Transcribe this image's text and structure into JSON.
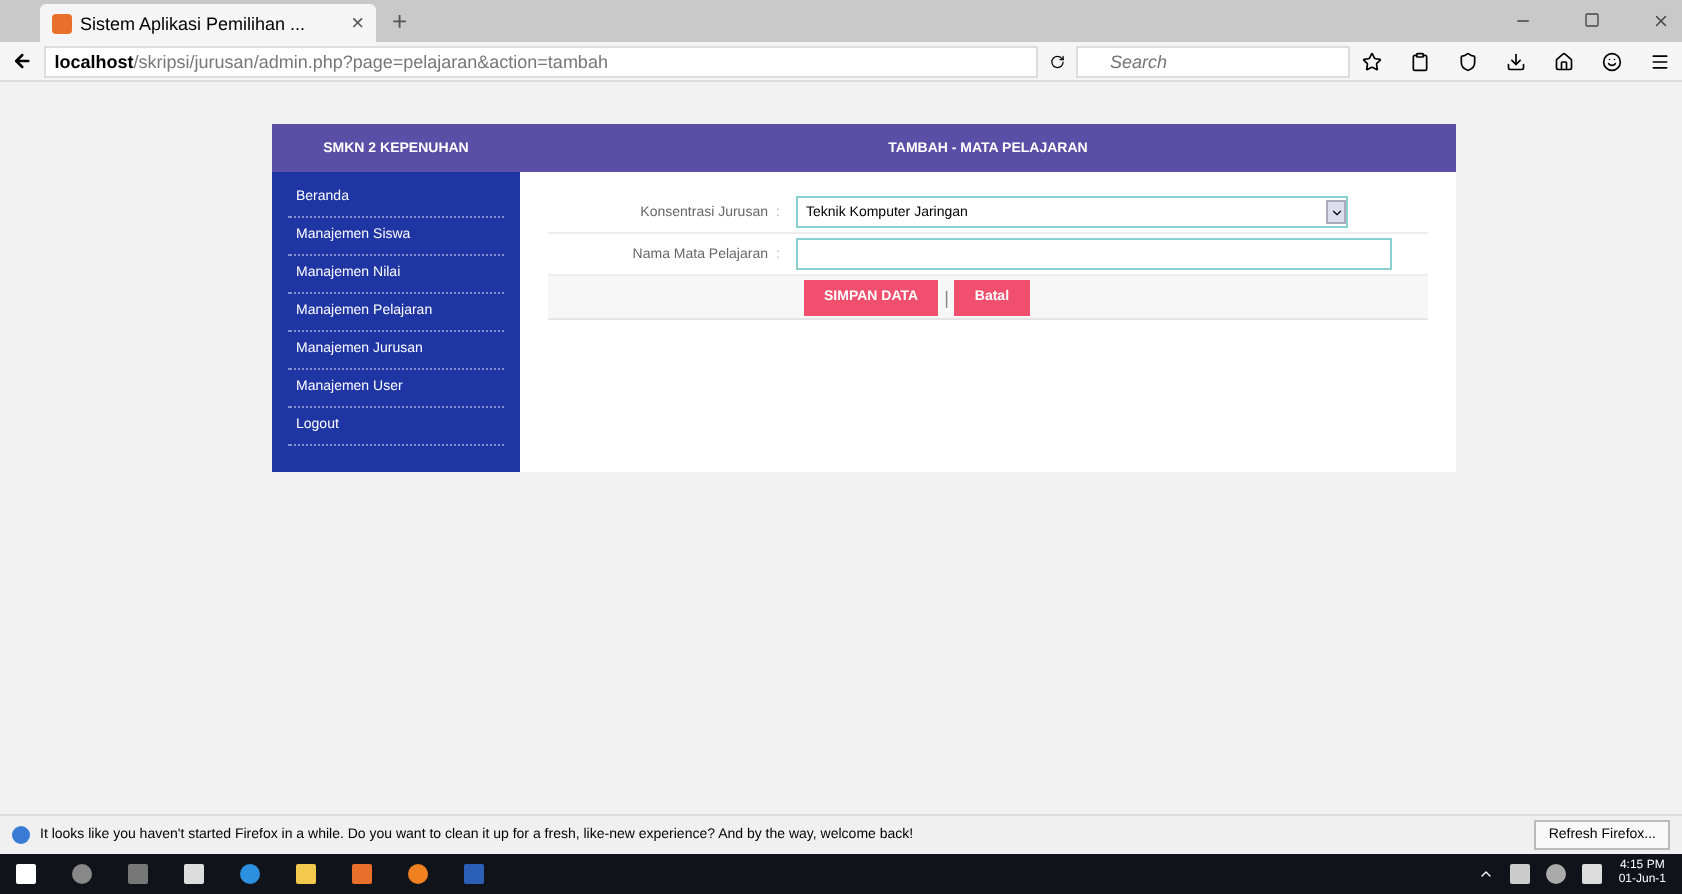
{
  "browser": {
    "tab": {
      "title": "Sistem Aplikasi Pemilihan ...",
      "close": "×"
    },
    "new_tab": "+",
    "url_host": "localhost",
    "url_path": "/skripsi/jurusan/admin.php?page=pelajaran&action=tambah",
    "search": {
      "placeholder": "Search"
    }
  },
  "app": {
    "brand": "SMKN 2 KEPENUHAN",
    "title": "TAMBAH - MATA PELAJARAN",
    "sidebar": [
      {
        "label": "Beranda"
      },
      {
        "label": "Manajemen Siswa"
      },
      {
        "label": "Manajemen Nilai"
      },
      {
        "label": "Manajemen Pelajaran"
      },
      {
        "label": "Manajemen Jurusan"
      },
      {
        "label": "Manajemen User"
      },
      {
        "label": "Logout"
      }
    ],
    "fields": [
      {
        "kind": "select",
        "label": "Konsentrasi Jurusan",
        "sep": ":",
        "value": "Teknik Komputer Jaringan"
      },
      {
        "kind": "text",
        "label": "Nama Mata Pelajaran",
        "sep": ":"
      }
    ],
    "buttons": [
      "SIMPAN DATA",
      "Batal"
    ],
    "button_sep": "|"
  },
  "notification": {
    "text": "It looks like you haven't started Firefox in a while. Do you want to clean it up for a fresh, like-new experience? And by the way, welcome back!",
    "button": "Refresh Firefox..."
  },
  "taskbar": {
    "time": "4:15 PM",
    "date": "01-Jun-1"
  }
}
